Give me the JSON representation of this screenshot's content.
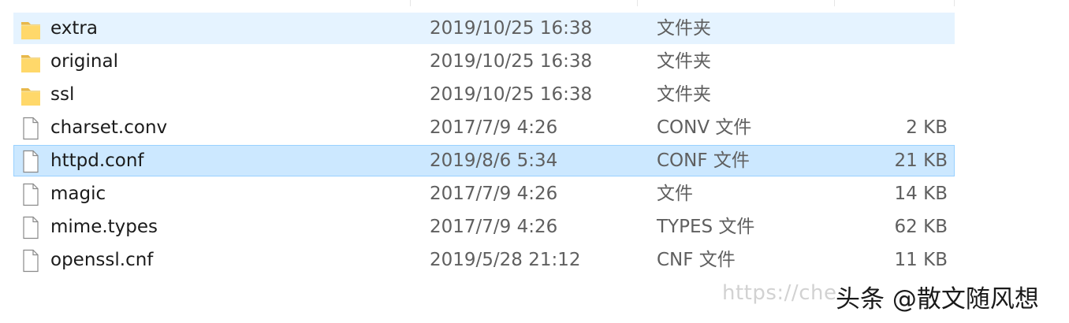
{
  "explorer": {
    "files": [
      {
        "name": "extra",
        "date": "2019/10/25 16:38",
        "type": "文件夹",
        "size": "",
        "icon": "folder-icon",
        "state": "hover"
      },
      {
        "name": "original",
        "date": "2019/10/25 16:38",
        "type": "文件夹",
        "size": "",
        "icon": "folder-icon",
        "state": ""
      },
      {
        "name": "ssl",
        "date": "2019/10/25 16:38",
        "type": "文件夹",
        "size": "",
        "icon": "folder-icon",
        "state": ""
      },
      {
        "name": "charset.conv",
        "date": "2017/7/9 4:26",
        "type": "CONV 文件",
        "size": "2 KB",
        "icon": "file-icon",
        "state": ""
      },
      {
        "name": "httpd.conf",
        "date": "2019/8/6 5:34",
        "type": "CONF 文件",
        "size": "21 KB",
        "icon": "file-icon",
        "state": "selected"
      },
      {
        "name": "magic",
        "date": "2017/7/9 4:26",
        "type": "文件",
        "size": "14 KB",
        "icon": "file-icon",
        "state": ""
      },
      {
        "name": "mime.types",
        "date": "2017/7/9 4:26",
        "type": "TYPES 文件",
        "size": "62 KB",
        "icon": "file-icon",
        "state": ""
      },
      {
        "name": "openssl.cnf",
        "date": "2019/5/28 21:12",
        "type": "CNF 文件",
        "size": "11 KB",
        "icon": "file-icon",
        "state": ""
      }
    ]
  },
  "watermark": {
    "url": "https://che",
    "brand": "头条 @散文随风想"
  },
  "colors": {
    "hover_bg": "#e5f3ff",
    "selected_bg": "#cce8ff",
    "selected_border": "#99d1ff",
    "folder_yellow": "#ffd86a"
  }
}
